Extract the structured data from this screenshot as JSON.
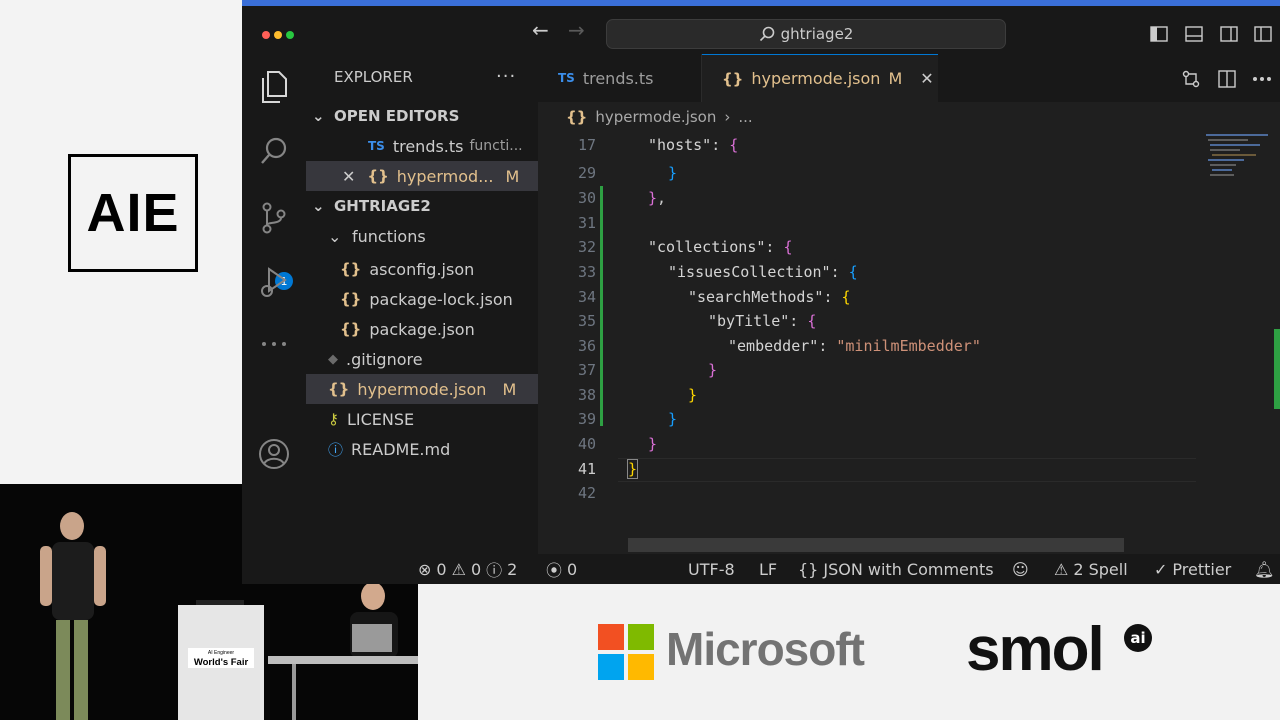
{
  "branding": {
    "aie_logo": "AIE",
    "podium_small": "AI Engineer",
    "podium_main": "World's Fair"
  },
  "titlebar": {
    "search_text": "ghtriage2"
  },
  "activity": {
    "source_control_badge": "1"
  },
  "sidebar": {
    "header": "EXPLORER",
    "open_editors_label": "OPEN EDITORS",
    "open_editors": [
      {
        "name": "trends.ts",
        "desc": "functi..."
      },
      {
        "name": "hypermod...",
        "status": "M"
      }
    ],
    "project_label": "GHTRIAGE2",
    "folder": "functions",
    "files": [
      {
        "name": "asconfig.json"
      },
      {
        "name": "package-lock.json"
      },
      {
        "name": "package.json"
      },
      {
        "name": ".gitignore"
      },
      {
        "name": "hypermode.json",
        "status": "M"
      },
      {
        "name": "LICENSE"
      },
      {
        "name": "README.md"
      }
    ]
  },
  "tabs": [
    {
      "label": "trends.ts",
      "lang": "TS"
    },
    {
      "label": "hypermode.json",
      "status": "M"
    }
  ],
  "breadcrumb": {
    "file": "hypermode.json",
    "more": "..."
  },
  "code": {
    "lines": [
      "17",
      "29",
      "30",
      "31",
      "32",
      "33",
      "34",
      "35",
      "36",
      "37",
      "38",
      "39",
      "40",
      "41",
      "42"
    ],
    "hosts_key": "\"hosts\"",
    "collections_key": "\"collections\"",
    "issues_key": "\"issuesCollection\"",
    "search_key": "\"searchMethods\"",
    "bytitle_key": "\"byTitle\"",
    "embedder_key": "\"embedder\"",
    "embedder_val": "\"minilmEmbedder\""
  },
  "status": {
    "errors": "0",
    "warnings": "0",
    "infos": "2",
    "ports": "0",
    "encoding": "UTF-8",
    "eol": "LF",
    "language": "JSON with Comments",
    "spell": "2 Spell",
    "formatter": "Prettier"
  },
  "sponsors": {
    "microsoft": "Microsoft",
    "smol": "smol",
    "smol_badge": "ai"
  },
  "colors": {
    "accent": "#0078d4",
    "modified": "#e2c08d",
    "string": "#ce9178"
  }
}
